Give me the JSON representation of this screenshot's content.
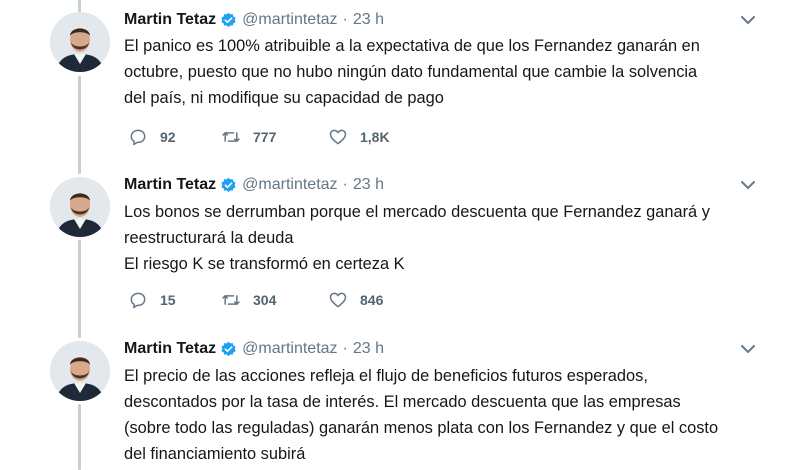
{
  "tweets": [
    {
      "author": "Martin Tetaz",
      "handle": "@martintetaz",
      "separator": "·",
      "time": "23 h",
      "lines": [
        "El panico es 100% atribuible a la expectativa de que los Fernandez ganarán en",
        "octubre, puesto que no hubo ningún dato fundamental que cambie la solvencia",
        "del país, ni modifique su capacidad de pago"
      ],
      "replies": "92",
      "retweets": "777",
      "likes": "1,8K"
    },
    {
      "author": "Martin Tetaz",
      "handle": "@martintetaz",
      "separator": "·",
      "time": "23 h",
      "lines": [
        "Los bonos se derrumban porque el mercado descuenta que Fernandez ganará y",
        "reestructurará la deuda",
        "El riesgo K se transformó en certeza K"
      ],
      "replies": "15",
      "retweets": "304",
      "likes": "846"
    },
    {
      "author": "Martin Tetaz",
      "handle": "@martintetaz",
      "separator": "·",
      "time": "23 h",
      "lines": [
        "El precio de las acciones refleja el flujo de beneficios futuros esperados,",
        "descontados por la tasa de interés. El mercado descuenta que las empresas",
        "(sobre todo las reguladas) ganarán menos plata con los Fernandez y que el costo",
        "del financiamiento subirá"
      ]
    }
  ],
  "colors": {
    "text": "#14171a",
    "secondary": "#657786",
    "verified": "#1da1f2",
    "thread_line": "#c4cfd6"
  },
  "icons": {
    "reply": "reply-icon",
    "retweet": "retweet-icon",
    "like": "heart-icon",
    "menu": "chevron-down-icon",
    "verified": "verified-badge-icon"
  }
}
